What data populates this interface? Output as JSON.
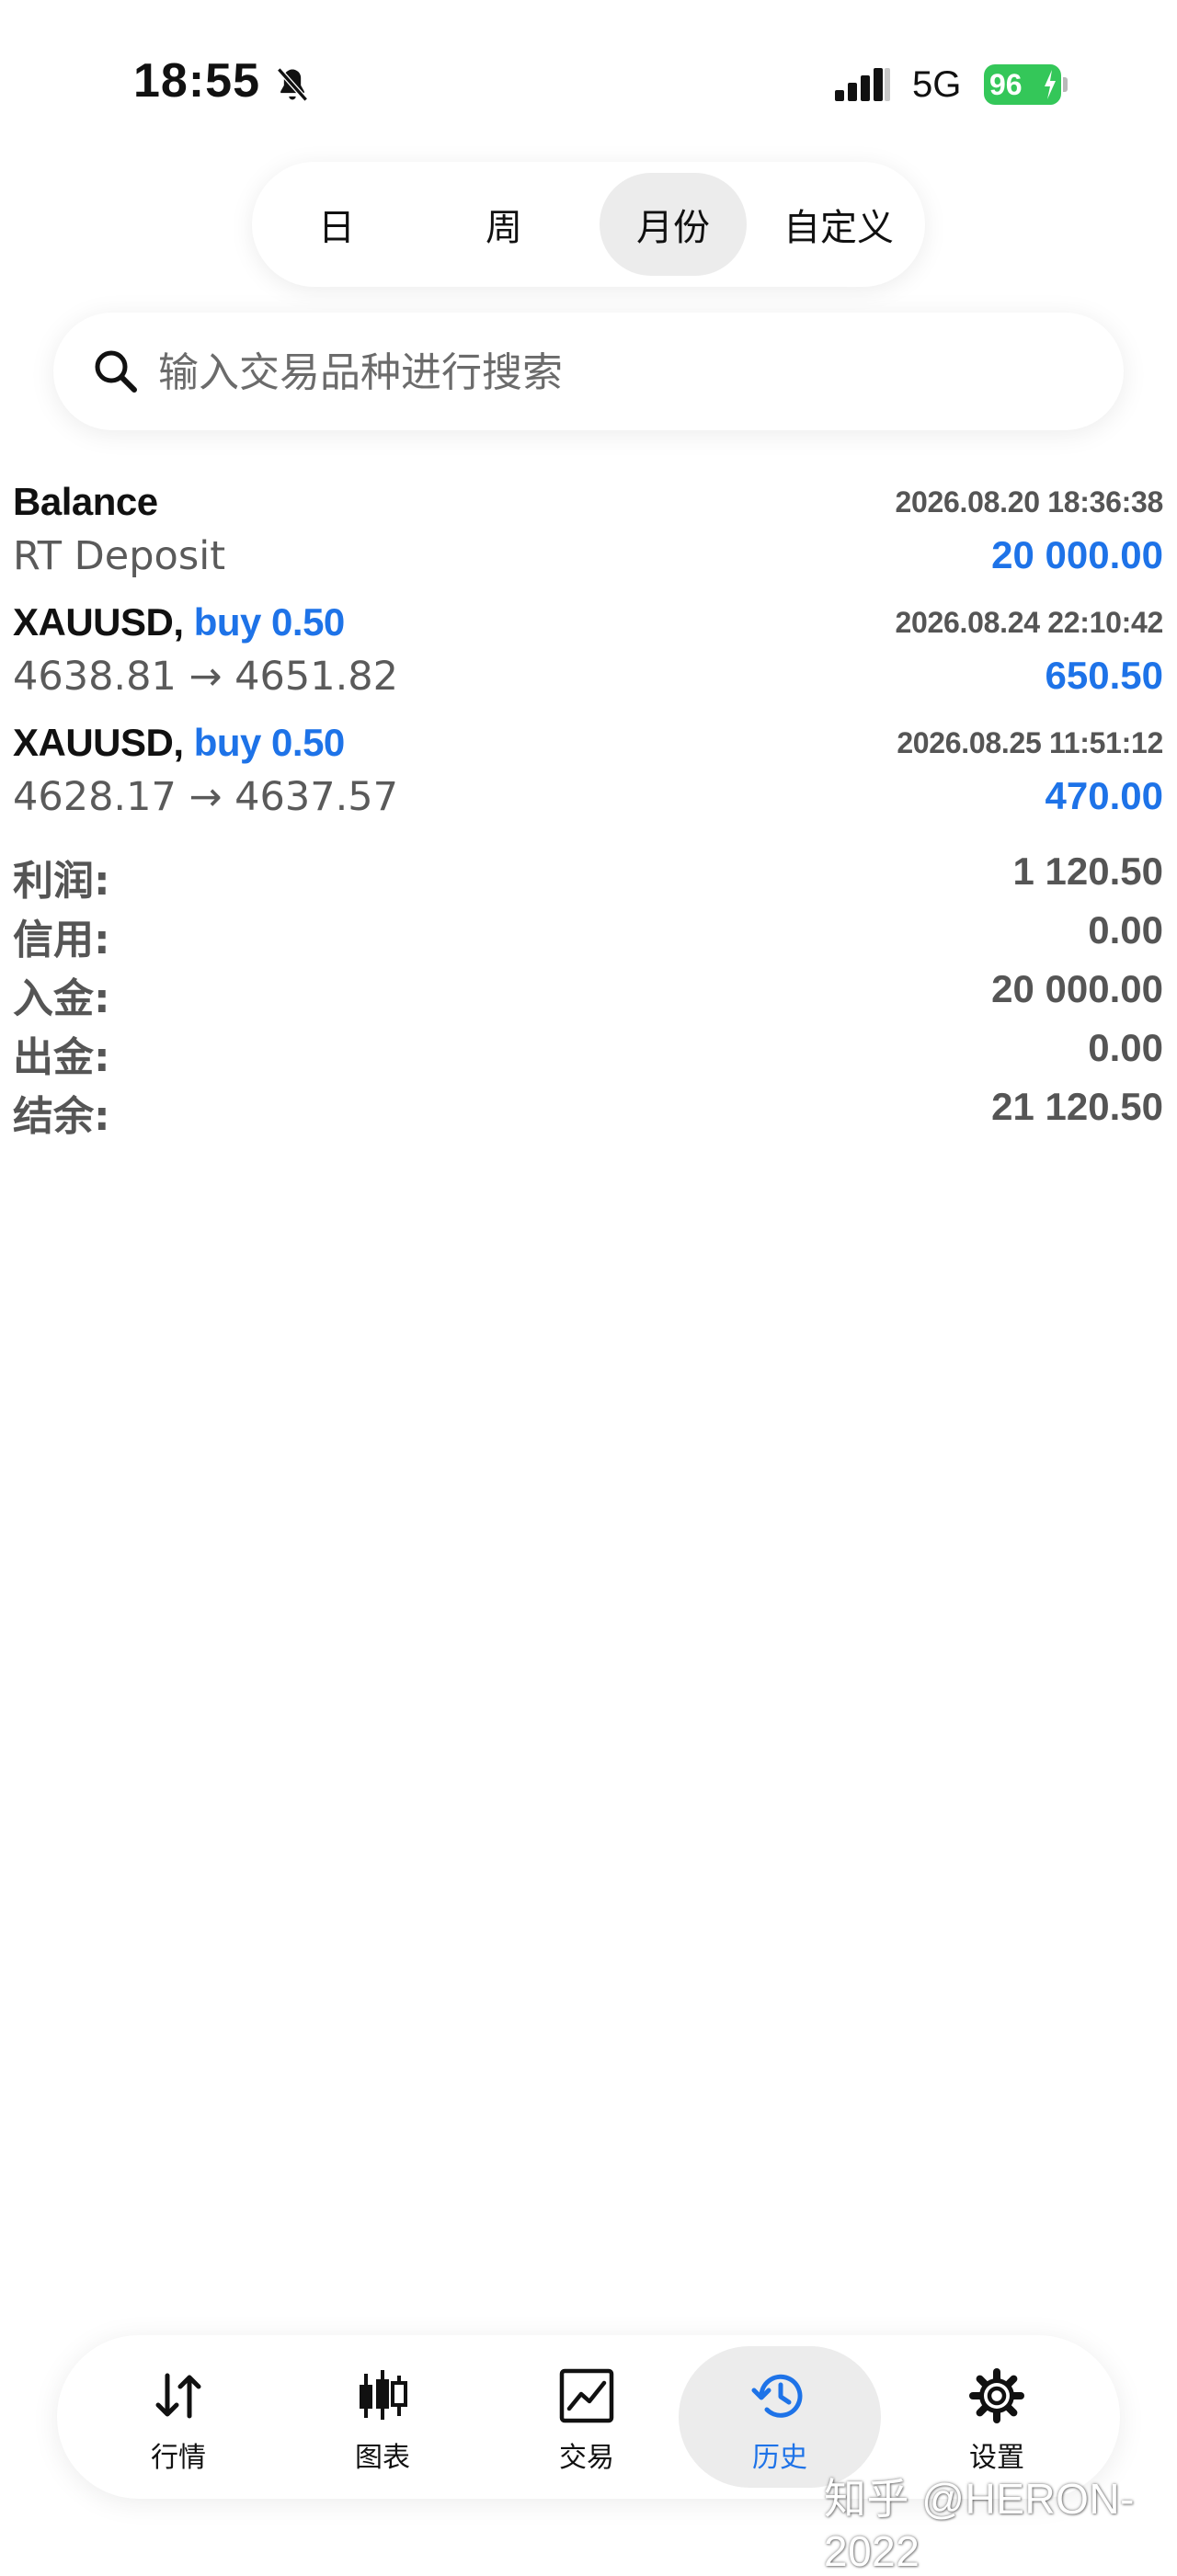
{
  "status_bar": {
    "time": "18:55",
    "network": "5G",
    "battery": "96",
    "icons": [
      "bell-muted-icon",
      "signal-icon",
      "battery-charging-icon"
    ]
  },
  "period_tabs": {
    "items": [
      {
        "label": "日"
      },
      {
        "label": "周"
      },
      {
        "label": "月份",
        "selected": true
      },
      {
        "label": "自定义"
      }
    ]
  },
  "search": {
    "placeholder": "输入交易品种进行搜索"
  },
  "history": {
    "deals": [
      {
        "title": "Balance",
        "side": "",
        "time": "2026.08.20 18:36:38",
        "description": "RT Deposit",
        "amount": "20 000.00"
      },
      {
        "title": "XAUUSD,",
        "side": "buy 0.50",
        "time": "2026.08.24 22:10:42",
        "description": "4638.81 → 4651.82",
        "amount": "650.50"
      },
      {
        "title": "XAUUSD,",
        "side": "buy 0.50",
        "time": "2026.08.25 11:51:12",
        "description": "4628.17 → 4637.57",
        "amount": "470.00"
      }
    ]
  },
  "summary": {
    "rows": [
      {
        "label": "利润:",
        "value": "1 120.50"
      },
      {
        "label": "信用:",
        "value": "0.00"
      },
      {
        "label": "入金:",
        "value": "20 000.00"
      },
      {
        "label": "出金:",
        "value": "0.00"
      },
      {
        "label": "结余:",
        "value": "21 120.50"
      }
    ]
  },
  "bottom_nav": {
    "items": [
      {
        "label": "行情",
        "icon": "quotes-arrows-icon"
      },
      {
        "label": "图表",
        "icon": "candlestick-chart-icon"
      },
      {
        "label": "交易",
        "icon": "trade-chart-icon"
      },
      {
        "label": "历史",
        "icon": "history-clock-icon",
        "selected": true
      },
      {
        "label": "设置",
        "icon": "gear-icon"
      }
    ]
  },
  "watermark": "知乎 @HERON-2022",
  "colors": {
    "accent": "#1e73e8",
    "battery": "#34c759",
    "muted_text": "#555555",
    "selected_bg": "#ececec"
  }
}
